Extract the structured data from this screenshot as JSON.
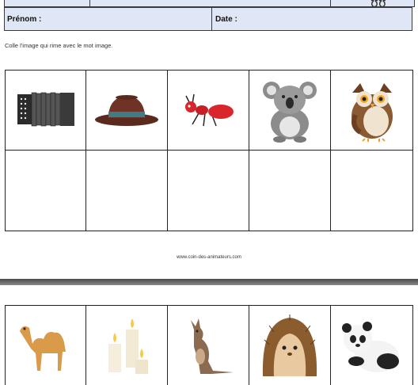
{
  "header": {
    "first_name_label": "Prénom :",
    "date_label": "Date :"
  },
  "instruction": "Colle l'image qui rime avec le mot image.",
  "footer": {
    "website": "www.coin-des-animateurs.com"
  },
  "page1": {
    "images": [
      "accordion-icon",
      "hat-icon",
      "ant-icon",
      "koala-icon",
      "owl-icon"
    ]
  },
  "page2": {
    "images": [
      "camel-icon",
      "candles-icon",
      "kangaroo-icon",
      "hedgehog-icon",
      "panda-icon"
    ]
  },
  "colors": {
    "header_fill": "#dfe6f5",
    "border": "#222222"
  }
}
